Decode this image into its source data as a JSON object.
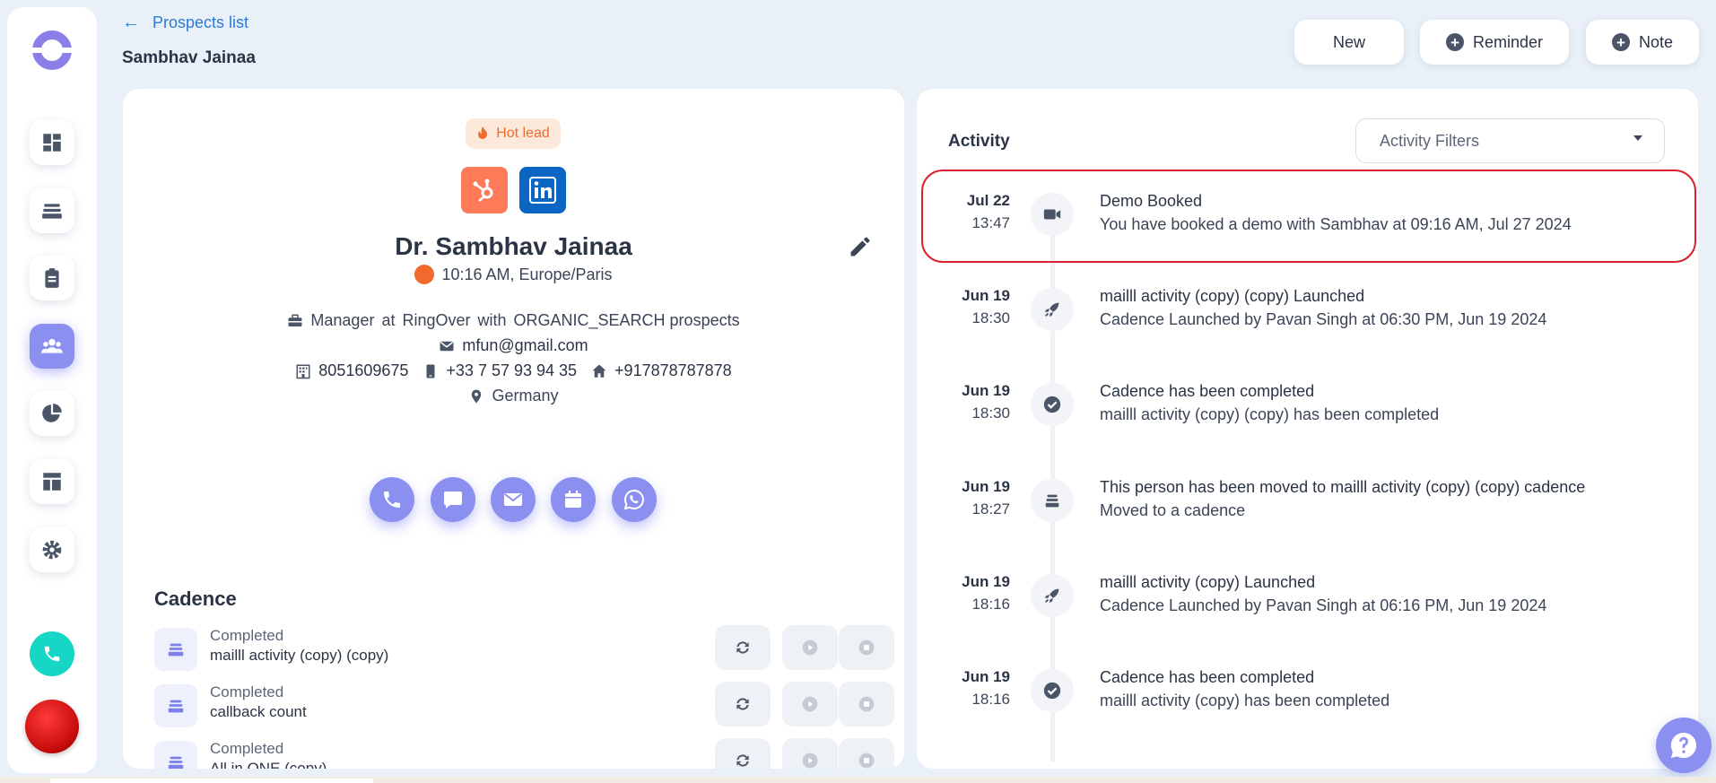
{
  "header": {
    "back_label": "Prospects list",
    "page_title": "Sambhav Jainaa",
    "new_label": "New",
    "reminder_label": "Reminder",
    "note_label": "Note"
  },
  "sidebar": {
    "items": [
      "dashboard-icon",
      "cadence-icon",
      "tasks-icon",
      "people-icon",
      "analytics-icon",
      "templates-icon",
      "settings-icon"
    ],
    "active": "people-icon"
  },
  "prospect": {
    "tag": "Hot lead",
    "name": "Dr. Sambhav Jainaa",
    "time_zone": "10:16 AM, Europe/Paris",
    "role": "Manager",
    "at": "at",
    "company": "RingOver",
    "with": "with",
    "source": "ORGANIC_SEARCH prospects",
    "email": "mfun@gmail.com",
    "phone_office": "8051609675",
    "phone_mobile": "+33 7 57 93 94 35",
    "phone_home": "+917878787878",
    "location": "Germany"
  },
  "cadence": {
    "title": "Cadence",
    "rows": [
      {
        "status": "Completed",
        "name": "mailll activity (copy) (copy)"
      },
      {
        "status": "Completed",
        "name": "callback count"
      },
      {
        "status": "Completed",
        "name": "All in ONE (copy)"
      }
    ]
  },
  "activity": {
    "title": "Activity",
    "filter_placeholder": "Activity Filters",
    "items": [
      {
        "date": "Jul 22",
        "time": "13:47",
        "icon": "video-icon",
        "title": "Demo Booked",
        "desc": "You have booked a demo with Sambhav at 09:16 AM, Jul 27 2024"
      },
      {
        "date": "Jun 19",
        "time": "18:30",
        "icon": "rocket-icon",
        "title": "mailll activity (copy) (copy) Launched",
        "desc": "Cadence Launched by Pavan Singh at 06:30 PM, Jun 19 2024"
      },
      {
        "date": "Jun 19",
        "time": "18:30",
        "icon": "check-circle-icon",
        "title": "Cadence has been completed",
        "desc": "mailll activity (copy) (copy) has been completed"
      },
      {
        "date": "Jun 19",
        "time": "18:27",
        "icon": "cadence-icon",
        "title": "This person has been moved to mailll activity (copy) (copy) cadence",
        "desc": "Moved to a cadence"
      },
      {
        "date": "Jun 19",
        "time": "18:16",
        "icon": "rocket-icon",
        "title": "mailll activity (copy) Launched",
        "desc": "Cadence Launched by Pavan Singh at 06:16 PM, Jun 19 2024"
      },
      {
        "date": "Jun 19",
        "time": "18:16",
        "icon": "check-circle-icon",
        "title": "Cadence has been completed",
        "desc": "mailll activity (copy) has been completed"
      }
    ]
  },
  "colors": {
    "accent": "#8a8ff0",
    "link": "#2b7bd9",
    "highlight_border": "#d9232d",
    "call_button": "#16d7c6",
    "hot_lead": "#ef6a2c"
  }
}
